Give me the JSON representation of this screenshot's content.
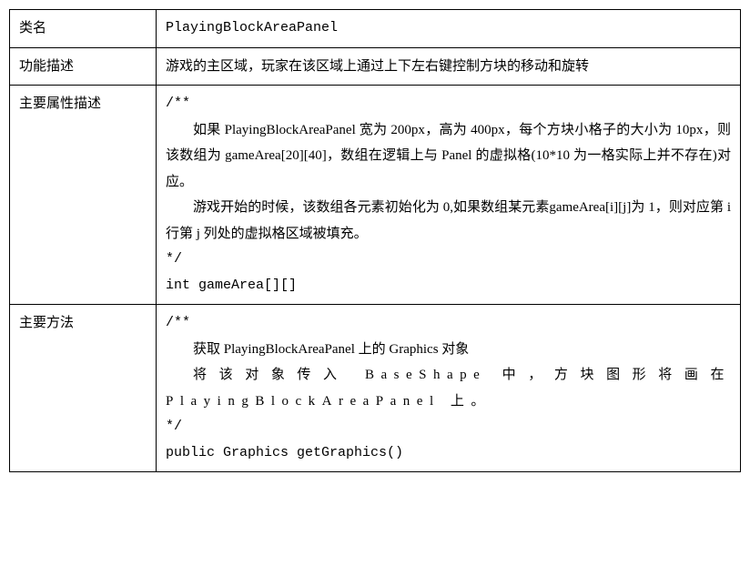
{
  "rows": [
    {
      "label": "类名",
      "content_lines": [
        {
          "text": "PlayingBlockAreaPanel",
          "cls": "no-indent mono"
        }
      ]
    },
    {
      "label": "功能描述",
      "content_lines": [
        {
          "text": "游戏的主区域，玩家在该区域上通过上下左右键控制方块的移动和旋转",
          "cls": "no-indent justify"
        }
      ]
    },
    {
      "label": "主要属性描述",
      "content_lines": [
        {
          "text": "/**",
          "cls": "no-indent mono"
        },
        {
          "text": "如果 PlayingBlockAreaPanel 宽为 200px，高为 400px，每个方块小格子的大小为 10px，则该数组为 gameArea[20][40]，数组在逻辑上与 Panel 的虚拟格(10*10 为一格实际上并不存在)对应。",
          "cls": "para-indent justify"
        },
        {
          "text": "游戏开始的时候，该数组各元素初始化为 0,如果数组某元素gameArea[i][j]为 1，则对应第 i 行第 j 列处的虚拟格区域被填充。",
          "cls": "para-indent justify"
        },
        {
          "text": "*/",
          "cls": "no-indent mono"
        },
        {
          "text": "int gameArea[][]",
          "cls": "no-indent mono"
        }
      ]
    },
    {
      "label": "主要方法",
      "content_lines": [
        {
          "text": "/**",
          "cls": "no-indent mono"
        },
        {
          "text": "获取 PlayingBlockAreaPanel 上的 Graphics 对象",
          "cls": "para-indent justify"
        },
        {
          "text": "将该对象传入 BaseShape 中，方块图形将画在PlayingBlockAreaPanel 上。",
          "cls": "para-indent justify sparse"
        },
        {
          "text": "*/",
          "cls": "no-indent mono"
        },
        {
          "text": "public Graphics  getGraphics()",
          "cls": "no-indent mono"
        }
      ]
    }
  ]
}
